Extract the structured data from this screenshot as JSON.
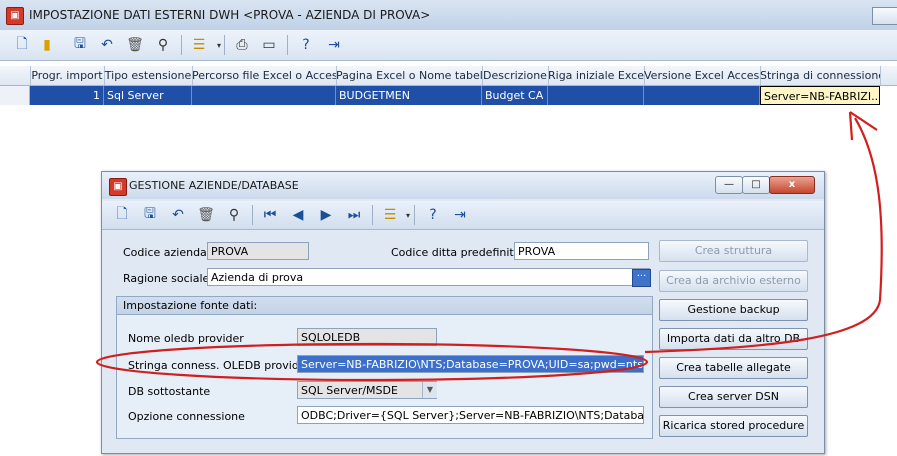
{
  "main_window": {
    "title": "IMPOSTAZIONE DATI ESTERNI DWH <PROVA - AZIENDA DI PROVA>",
    "toolbar_icons": [
      "new-icon",
      "open-icon",
      "save-icon",
      "undo-icon",
      "delete-icon",
      "find-icon",
      "list-icon",
      "print-icon",
      "monitor-icon",
      "help-icon",
      "exit-icon"
    ],
    "grid": {
      "columns": [
        "Progr. import",
        "Tipo estensione",
        "Percorso file Excel o Access",
        "Pagina Excel o Nome tabella",
        "Descrizione",
        "Riga iniziale Excel",
        "Versione Excel Access",
        "Stringa di connessione"
      ],
      "rows": [
        [
          "1",
          "Sql Server",
          "",
          "BUDGETMEN",
          "Budget CA",
          "",
          "",
          "Server=NB-FABRIZI..."
        ]
      ]
    }
  },
  "dialog": {
    "title": "GESTIONE AZIENDE/DATABASE",
    "window_controls": {
      "minimize": "—",
      "maximize": "□",
      "close": "x"
    },
    "toolbar_icons": [
      "new-icon",
      "save-icon",
      "undo-icon",
      "delete-icon",
      "find-icon",
      "first-icon",
      "prev-icon",
      "next-icon",
      "last-icon",
      "list-icon",
      "help-icon",
      "exit-icon"
    ],
    "codice_azienda_label": "Codice azienda",
    "codice_azienda_value": "PROVA",
    "codice_ditta_label": "Codice ditta predefinito",
    "codice_ditta_value": "PROVA",
    "ragione_sociale_label": "Ragione sociale",
    "ragione_sociale_value": "Azienda di prova",
    "group_title": "Impostazione fonte dati:",
    "oledb_provider_label": "Nome oledb provider",
    "oledb_provider_value": "SQLOLEDB",
    "stringa_label": "Stringa conness. OLEDB provider",
    "stringa_value": "Server=NB-FABRIZIO\\NTS;Database=PROVA;UID=sa;pwd=nts;LANG",
    "db_label": "DB sottostante",
    "db_value": "SQL Server/MSDE",
    "opzione_label": "Opzione connessione",
    "opzione_value": "ODBC;Driver={SQL Server};Server=NB-FABRIZIO\\NTS;Database=PRC",
    "buttons": {
      "crea_struttura": "Crea struttura",
      "crea_archivio": "Crea da archivio esterno",
      "gestione_backup": "Gestione backup",
      "importa_dati": "Importa dati da altro DB",
      "crea_tabelle": "Crea tabelle allegate",
      "crea_dsn": "Crea server DSN",
      "ricarica": "Ricarica stored procedure"
    }
  },
  "colors": {
    "annotation": "#d11f1f",
    "selection": "#1f4fa6",
    "accent": "#3b6fc9"
  }
}
